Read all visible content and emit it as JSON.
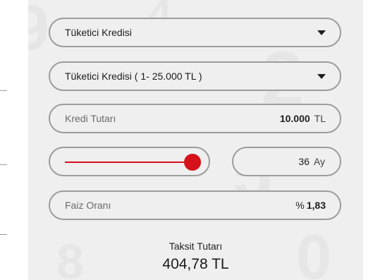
{
  "credit_type": {
    "selected": "Tüketici Kredisi"
  },
  "credit_range": {
    "selected": "Tüketici Kredisi ( 1- 25.000 TL )"
  },
  "amount": {
    "label": "Kredi Tutarı",
    "value": "10.000",
    "unit": "TL"
  },
  "term": {
    "value": "36",
    "unit": "Ay",
    "slider_fraction": 1.0
  },
  "interest": {
    "label": "Faiz Oranı",
    "prefix": "%",
    "value": "1,83"
  },
  "result": {
    "label": "Taksit Tutarı",
    "value": "404,78 TL"
  },
  "colors": {
    "accent": "#d6111a",
    "panel_bg": "#efefef",
    "border": "#9c9c9c"
  }
}
